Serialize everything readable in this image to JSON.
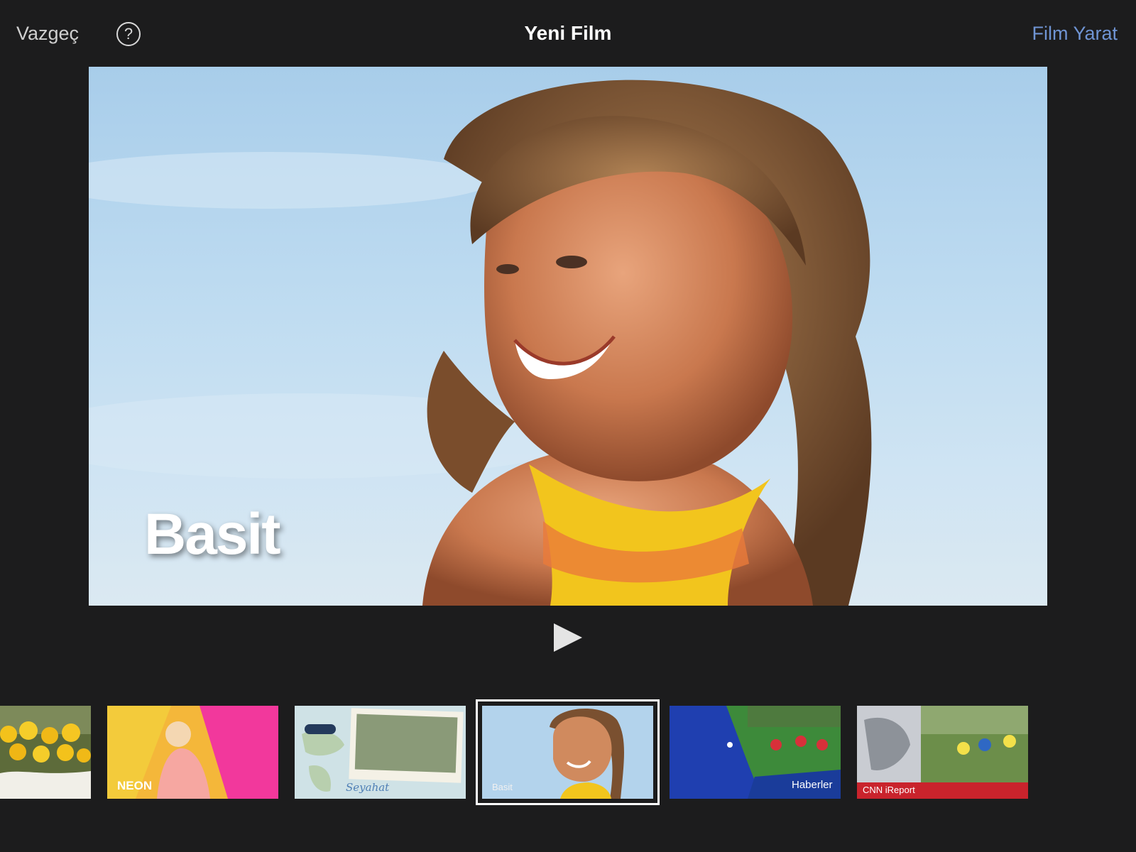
{
  "toolbar": {
    "cancel_label": "Vazgeç",
    "help_label": "?",
    "title": "Yeni Film",
    "create_label": "Film Yarat"
  },
  "preview": {
    "title": "Basit"
  },
  "themes": [
    {
      "label": ""
    },
    {
      "label": "NEON"
    },
    {
      "label": "Seyahat"
    },
    {
      "label": "Basit"
    },
    {
      "label": "Haberler"
    },
    {
      "label": "CNN iReport"
    }
  ],
  "selected_theme": "Basit",
  "colors": {
    "background": "#1c1c1d",
    "accent": "#6f94d3"
  }
}
